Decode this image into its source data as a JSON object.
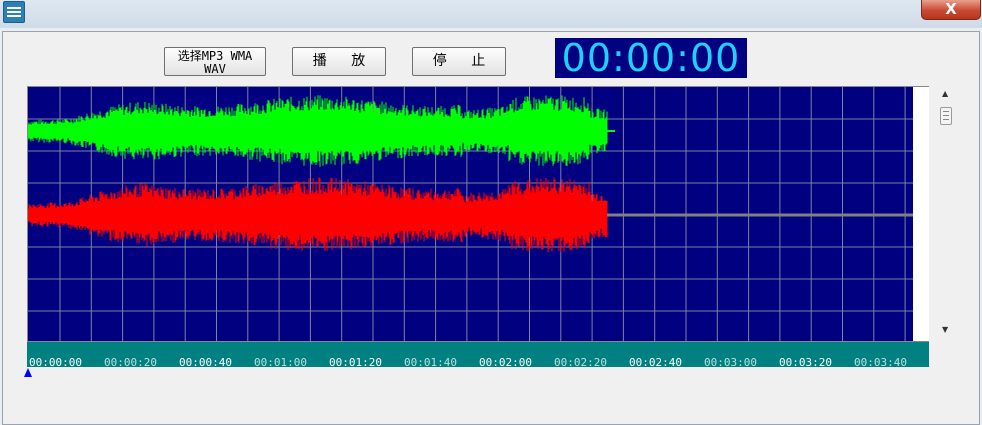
{
  "window": {
    "title": "",
    "close_label": "X"
  },
  "toolbar": {
    "select_label_line1": "选择MP3 WMA",
    "select_label_line2": "WAV",
    "play_label": "播 放",
    "stop_label": "停 止"
  },
  "timer": {
    "display": "00:00:00"
  },
  "timeline": {
    "labels": [
      "00:00:00",
      "00:00:20",
      "00:00:40",
      "00:01:00",
      "00:01:20",
      "00:01:40",
      "00:02:00",
      "00:02:20",
      "00:02:40",
      "00:03:00",
      "00:03:20",
      "00:03:40"
    ]
  },
  "waveform": {
    "channels": [
      {
        "name": "",
        "color": "#00ff00"
      },
      {
        "name": "",
        "color": "#ff0000"
      }
    ],
    "background_color": "#000080",
    "grid_color": "#8080a0",
    "timeline_color": "#008080",
    "loaded_fraction": 0.65
  },
  "colors": {
    "timer_text": "#1fd1ff",
    "timer_background": "#000080",
    "playhead": "#0000ff"
  }
}
